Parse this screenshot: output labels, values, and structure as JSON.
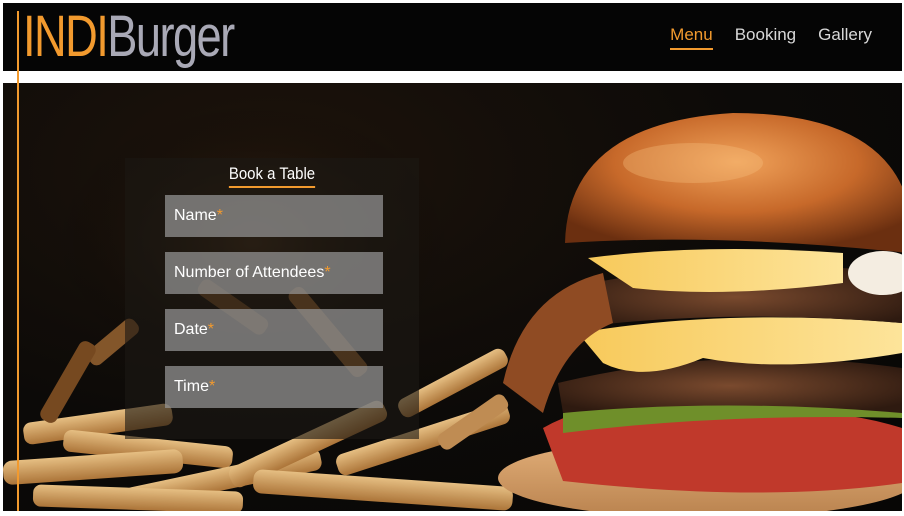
{
  "brand": {
    "logo_part1": "INDI",
    "logo_part2": "Burger"
  },
  "nav": {
    "items": [
      {
        "label": "Menu",
        "active": true
      },
      {
        "label": "Booking",
        "active": false
      },
      {
        "label": "Gallery",
        "active": false
      }
    ]
  },
  "hero": {
    "image": "burger-and-fries-photo"
  },
  "booking": {
    "title": "Book a Table",
    "fields": [
      {
        "label": "Name",
        "required_mark": "*"
      },
      {
        "label": "Number of Attendees",
        "required_mark": "*"
      },
      {
        "label": "Date",
        "required_mark": "*"
      },
      {
        "label": "Time",
        "required_mark": "*"
      }
    ]
  },
  "colors": {
    "accent": "#f29a2e",
    "logo_secondary": "#a9a9b6",
    "navbar_bg": "#050505",
    "nav_text": "#d8d8d8"
  }
}
